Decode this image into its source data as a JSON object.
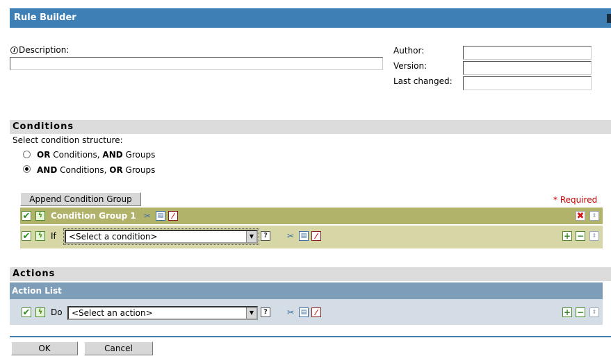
{
  "window": {
    "title": "Rule Builder"
  },
  "description": {
    "label": "Description:",
    "value": "",
    "info_icon": "info-icon"
  },
  "meta": {
    "author_label": "Author:",
    "author_value": "",
    "version_label": "Version:",
    "version_value": "",
    "last_changed_label": "Last changed:",
    "last_changed_value": ""
  },
  "conditions": {
    "header": "Conditions",
    "structure_prompt": "Select condition structure:",
    "options": [
      {
        "bold1": "OR",
        "text1": " Conditions, ",
        "bold2": "AND",
        "text2": " Groups",
        "checked": false
      },
      {
        "bold1": "AND",
        "text1": " Conditions, ",
        "bold2": "OR",
        "text2": " Groups",
        "checked": true
      }
    ],
    "append_button": "Append Condition Group",
    "required_note": "* Required",
    "group": {
      "title": "Condition Group 1",
      "row": {
        "prefix": "If",
        "select_value": "<Select a condition>",
        "help": "?"
      }
    }
  },
  "actions": {
    "header": "Actions",
    "list_title": "Action List",
    "row": {
      "prefix": "Do",
      "select_value": "<Select an action>",
      "help": "?"
    }
  },
  "footer": {
    "ok_label": "OK",
    "cancel_label": "Cancel"
  },
  "icons": {
    "check": "✔",
    "toggle": "ϟ",
    "cut": "✂",
    "copy": "▤",
    "paste": "⁄",
    "add": "+",
    "remove": "−",
    "move": "⇕",
    "delete": "✖",
    "dropdown": "▼"
  },
  "colors": {
    "title_bar": "#3e7fb5",
    "section_header": "#dcdcdc",
    "group_header": "#b2b36b",
    "group_row": "#d6d6a6",
    "action_header": "#7e9db8",
    "action_row": "#d4dde5",
    "required": "#c00000"
  }
}
